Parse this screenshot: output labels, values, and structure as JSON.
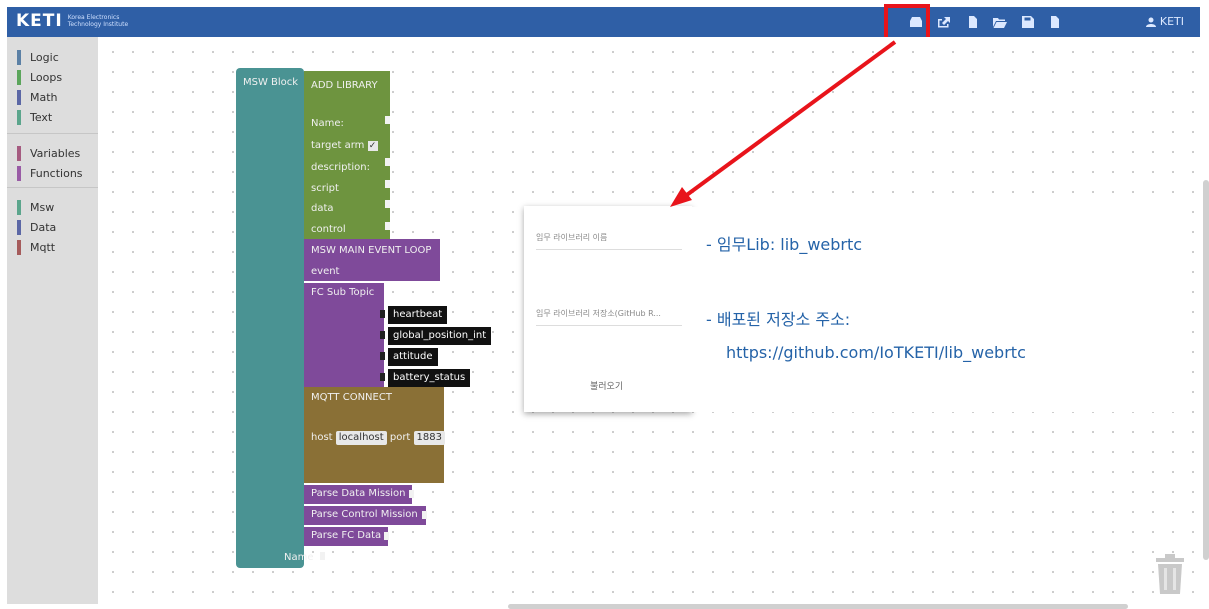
{
  "header": {
    "logo_text": "KETI",
    "logo_subtitle_line1": "Korea Electronics",
    "logo_subtitle_line2": "Technology Institute",
    "user_label": "KETI",
    "bg_color": "#2f5fa6",
    "toolbar_icons": [
      "load-library-icon",
      "export-icon",
      "new-file-icon",
      "open-folder-icon",
      "save-icon",
      "save-as-icon"
    ]
  },
  "sidebar": {
    "categories": [
      {
        "label": "Logic",
        "color": "#5b80a5"
      },
      {
        "label": "Loops",
        "color": "#5ba55b"
      },
      {
        "label": "Math",
        "color": "#5b67a5"
      },
      {
        "label": "Text",
        "color": "#5ba58c"
      },
      {
        "label": "Variables",
        "color": "#a55b80"
      },
      {
        "label": "Functions",
        "color": "#995ba5"
      },
      {
        "label": "Msw",
        "color": "#5ba58c"
      },
      {
        "label": "Data",
        "color": "#5b67a5"
      },
      {
        "label": "Mqtt",
        "color": "#a55b5b"
      }
    ]
  },
  "blocks": {
    "msw_block": {
      "title": "MSW Block",
      "name_label": "Name",
      "color": "#4a9393"
    },
    "add_library": {
      "title": "ADD LIBRARY",
      "fields": [
        "Name:",
        "target  arm",
        "description:",
        "script",
        "data",
        "control"
      ],
      "color": "#6e943f"
    },
    "main_event_loop": {
      "title": "MSW MAIN EVENT LOOP",
      "event_label": "event",
      "color": "#7f4a9a"
    },
    "fc_sub_topic": {
      "title": "FC Sub Topic",
      "topics": [
        "heartbeat",
        "global_position_int",
        "attitude",
        "battery_status"
      ],
      "color": "#7f4a9a"
    },
    "mqtt_connect": {
      "title": "MQTT CONNECT",
      "host_label": "host",
      "host_value": "localhost",
      "port_label": "port",
      "port_value": "1883",
      "color": "#8a7036"
    },
    "parse_data": "Parse Data Mission",
    "parse_control": "Parse Control Mission",
    "parse_fc": "Parse FC Data"
  },
  "dialog": {
    "field1_placeholder": "임무 라이브러리 이름",
    "field2_placeholder": "임무 라이브러리 저장소(GitHub R...",
    "load_button": "불러오기"
  },
  "callout": {
    "line1": "- 임무Lib: lib_webrtc",
    "line2": "- 배포된 저장소 주소:",
    "line3": "https://github.com/IoTKETI/lib_webrtc",
    "text_color": "#2563a8"
  },
  "annotation": {
    "color": "#e8141b"
  }
}
